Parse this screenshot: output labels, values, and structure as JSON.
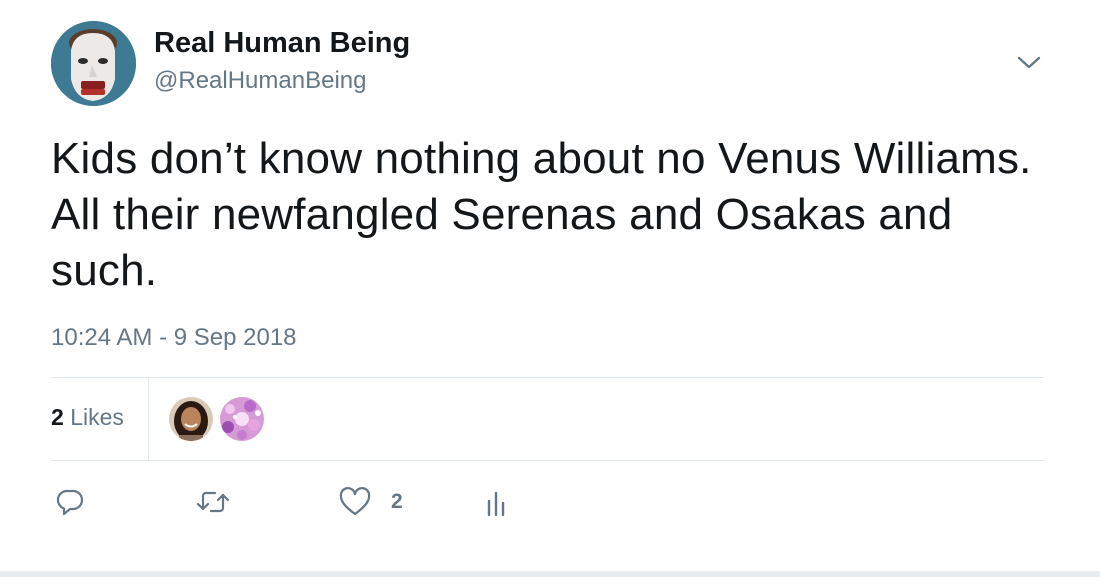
{
  "author": {
    "display_name": "Real Human Being",
    "handle": "@RealHumanBeing",
    "avatar_icon": "mask-face-avatar"
  },
  "tweet": {
    "text": "Kids don’t know nothing about no Venus Williams. All their newfangled Serenas and Osakas and such.",
    "timestamp": "10:24 AM - 9 Sep 2018"
  },
  "stats": {
    "likes_count": "2",
    "likes_label": "Likes",
    "liker_avatars": [
      "liker-avatar-woman",
      "liker-avatar-glitter"
    ]
  },
  "actions": {
    "reply_icon": "reply-icon",
    "retweet_icon": "retweet-icon",
    "like_icon": "heart-icon",
    "like_count": "2",
    "analytics_icon": "analytics-icon"
  },
  "colors": {
    "text_primary": "#14171a",
    "text_secondary": "#657786",
    "divider": "#e1e8ed",
    "avatar_bg": "#3f7a94"
  }
}
